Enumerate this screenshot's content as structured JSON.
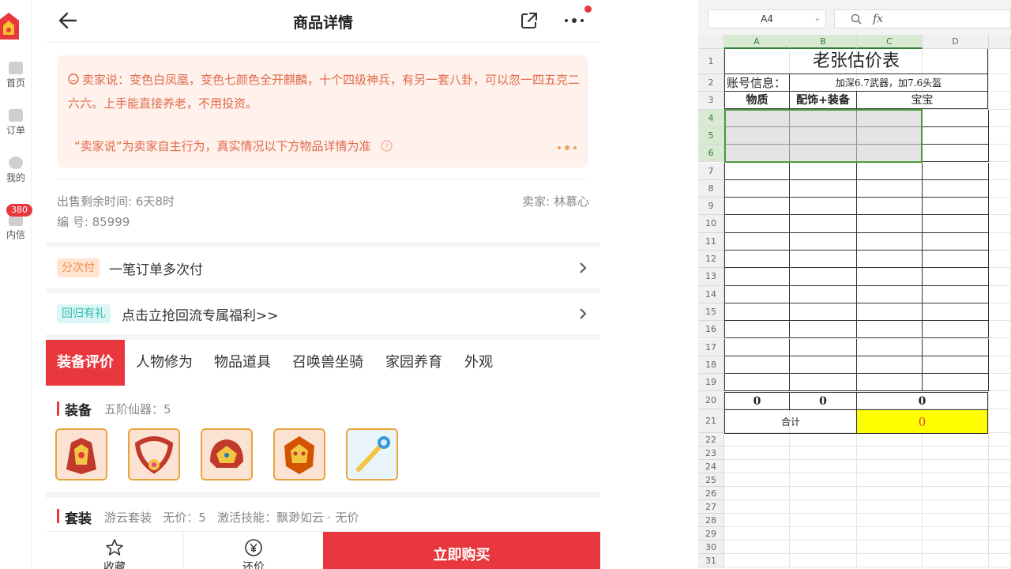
{
  "nav": {
    "items": [
      {
        "label": "首页",
        "icon": "home-icon"
      },
      {
        "label": "订单",
        "icon": "order-icon"
      },
      {
        "label": "我的",
        "icon": "profile-icon"
      },
      {
        "label": "内信",
        "icon": "message-icon"
      }
    ],
    "message_badge": "380"
  },
  "header": {
    "title": "商品详情"
  },
  "seller": {
    "says": "卖家说：变色白凤凰，变色七颜色全开麒麟，十个四级神兵，有另一套八卦，可以忽一四五克二六六。上手能直接养老，不用投资。",
    "disclaimer": "“卖家说”为卖家自主行为，真实情况以下方物品详情为准",
    "remaining_time": "出售剩余时间: 6天8时",
    "seller_name": "卖家: 林慕心",
    "serial": "编 号: 85999"
  },
  "rows": {
    "installment_tag": "分次付",
    "installment_text": "一笔订单多次付",
    "return_tag": "回归有礼",
    "return_text": "点击立抢回流专属福利>>"
  },
  "tabs": [
    "装备评价",
    "人物修为",
    "物品道具",
    "召唤兽坐骑",
    "家园养育",
    "外观"
  ],
  "equipment": {
    "title": "装备",
    "subtitle": "五阶仙器：5",
    "items": [
      "equipment-armor-icon",
      "equipment-necklace-icon",
      "equipment-helmet-icon",
      "equipment-mask-icon",
      "equipment-staff-icon"
    ]
  },
  "suit": {
    "title": "套装",
    "subtitle": "游云套装   无价：5   激活技能：飘渺如云 · 无价"
  },
  "bottom": {
    "favorite": "收藏",
    "offer": "还价",
    "buy": "立即购买"
  },
  "colors": {
    "accent": "#e8383d",
    "seller_bg": "#fff1ec",
    "installment_tag_bg": "#ffe4d2",
    "return_tag_bg": "#dbf6f4",
    "highlight_yellow": "#ffff00",
    "selection_green": "#4a9a3c"
  },
  "spreadsheet": {
    "cell_ref": "A4",
    "fx": "fx",
    "columns": [
      "A",
      "B",
      "C",
      "D"
    ],
    "rows": [
      "1",
      "2",
      "3",
      "4",
      "5",
      "6",
      "7",
      "8",
      "9",
      "10",
      "11",
      "12",
      "13",
      "14",
      "15",
      "16",
      "17",
      "18",
      "19",
      "20",
      "21",
      "22",
      "23",
      "24",
      "25",
      "26",
      "27",
      "28",
      "29",
      "30",
      "31"
    ],
    "title": "老张估价表",
    "account_label": "账号信息：",
    "account_value": "加深6.7武器，加7.6头盔",
    "header_a": "物质",
    "header_b": "配饰+装备",
    "header_c": "宝宝",
    "total_a": "0",
    "total_b": "0",
    "total_c": "0",
    "sum_label": "合计",
    "sum_value": "0"
  }
}
